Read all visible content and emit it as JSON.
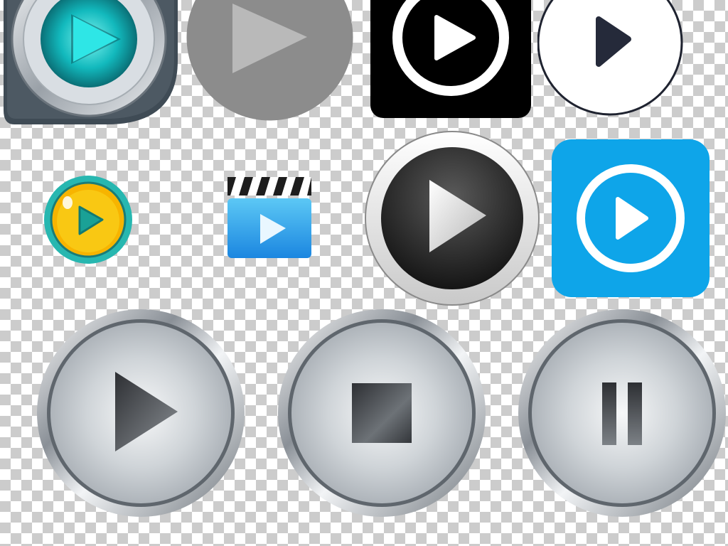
{
  "title": "",
  "icons": [
    {
      "name": "metallic-teal-play-button-icon",
      "shape": "play"
    },
    {
      "name": "gray-circle-play-icon",
      "shape": "play"
    },
    {
      "name": "black-square-ring-play-icon",
      "shape": "play"
    },
    {
      "name": "white-circle-play-icon",
      "shape": "play"
    },
    {
      "name": "yellow-cartoon-play-icon",
      "shape": "play"
    },
    {
      "name": "clapperboard-video-play-icon",
      "shape": "play"
    },
    {
      "name": "dark-glossy-play-button-icon",
      "shape": "play"
    },
    {
      "name": "blue-square-ring-play-icon",
      "shape": "play"
    },
    {
      "name": "chrome-play-button-icon",
      "shape": "play"
    },
    {
      "name": "chrome-stop-button-icon",
      "shape": "stop"
    },
    {
      "name": "chrome-pause-button-icon",
      "shape": "pause"
    }
  ],
  "colors": {
    "checker_light": "#ffffff",
    "checker_dark": "#cccccc",
    "teal_accent": "#1fc9c9",
    "blue_accent": "#0ea5e9",
    "yellow_accent": "#f5b800",
    "dark_button": "#2a2a2a",
    "chrome": "#c9cdd1"
  }
}
